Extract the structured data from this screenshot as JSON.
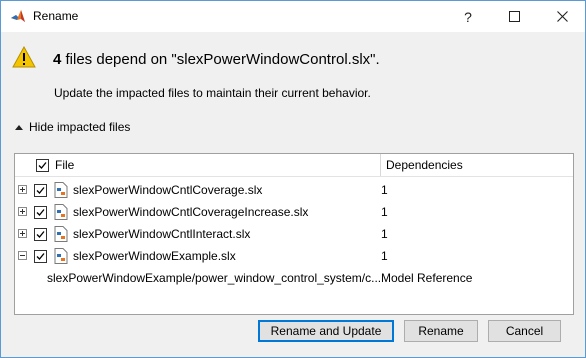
{
  "window": {
    "title": "Rename",
    "controls": {
      "help": "?",
      "maximize": "maximize",
      "close": "close"
    }
  },
  "message": {
    "count": "4",
    "heading_rest": " files depend on \"slexPowerWindowControl.slx\".",
    "subtext": "Update the impacted files to maintain their current behavior."
  },
  "toggle": {
    "label": "Hide impacted files"
  },
  "table": {
    "columns": {
      "file": "File",
      "dependencies": "Dependencies"
    },
    "rows": [
      {
        "name": "slexPowerWindowCntlCoverage.slx",
        "deps": "1",
        "expanded": false,
        "checked": true
      },
      {
        "name": "slexPowerWindowCntlCoverageIncrease.slx",
        "deps": "1",
        "expanded": false,
        "checked": true
      },
      {
        "name": "slexPowerWindowCntlInteract.slx",
        "deps": "1",
        "expanded": false,
        "checked": true
      },
      {
        "name": "slexPowerWindowExample.slx",
        "deps": "1",
        "expanded": true,
        "checked": true
      }
    ],
    "detail": {
      "path": "slexPowerWindowExample/power_window_control_system/c...",
      "type": "Model Reference"
    }
  },
  "buttons": {
    "rename_update": "Rename and Update",
    "rename": "Rename",
    "cancel": "Cancel"
  },
  "colors": {
    "accent": "#0078d7",
    "warning": "#f5c400",
    "window_border": "#5b9bd5"
  }
}
